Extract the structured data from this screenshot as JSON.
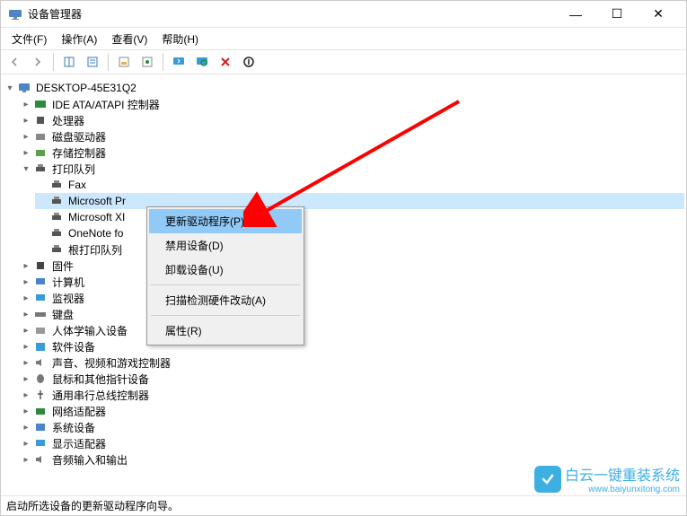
{
  "window": {
    "title": "设备管理器"
  },
  "winctrl": {
    "min": "—",
    "max": "☐",
    "close": "✕"
  },
  "menu": {
    "file": "文件(F)",
    "action": "操作(A)",
    "view": "查看(V)",
    "help": "帮助(H)"
  },
  "root": {
    "label": "DESKTOP-45E31Q2"
  },
  "cat": {
    "ide": "IDE ATA/ATAPI 控制器",
    "cpu": "处理器",
    "disk": "磁盘驱动器",
    "storage": "存储控制器",
    "printq": "打印队列",
    "firmware": "固件",
    "computer": "计算机",
    "monitor": "监视器",
    "keyboard": "键盘",
    "hid": "人体学输入设备",
    "software": "软件设备",
    "sound": "声音、视频和游戏控制器",
    "mouse": "鼠标和其他指针设备",
    "usb": "通用串行总线控制器",
    "network": "网络适配器",
    "system": "系统设备",
    "display": "显示适配器",
    "audioio": "音频输入和输出"
  },
  "printers": {
    "fax": "Fax",
    "msp": "Microsoft Pr",
    "msxps": "Microsoft XI",
    "onenote": "OneNote fo",
    "root": "根打印队列"
  },
  "context": {
    "update": "更新驱动程序(P)",
    "disable": "禁用设备(D)",
    "uninstall": "卸载设备(U)",
    "scan": "扫描检测硬件改动(A)",
    "properties": "属性(R)"
  },
  "status": "启动所选设备的更新驱动程序向导。",
  "watermark": {
    "text": "白云一键重装系统",
    "url": "www.baiyunxitong.com"
  }
}
